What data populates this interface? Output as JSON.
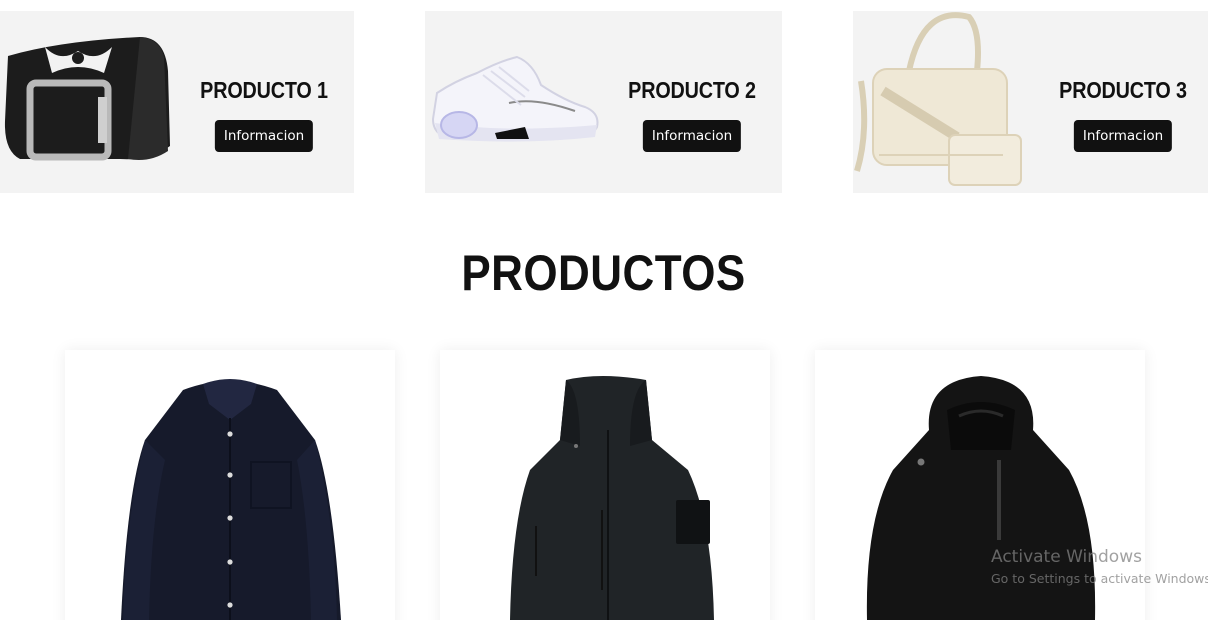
{
  "featured": [
    {
      "title": "PRODUCTO 1",
      "button_label": "Informacion",
      "image": "belt-image"
    },
    {
      "title": "PRODUCTO 2",
      "button_label": "Informacion",
      "image": "sneaker-image"
    },
    {
      "title": "PRODUCTO 3",
      "button_label": "Informacion",
      "image": "bag-image"
    }
  ],
  "products_section": {
    "title": "PRODUCTOS",
    "items": [
      {
        "image": "dress-shirt-image"
      },
      {
        "image": "softshell-jacket-image"
      },
      {
        "image": "hooded-jacket-image"
      }
    ]
  },
  "watermark": {
    "line1": "Activate Windows",
    "line2": "Go to Settings to activate Windows."
  },
  "colors": {
    "card_background": "#f3f3f3",
    "button_background": "#111111",
    "button_text": "#ffffff",
    "heading": "#111111"
  }
}
